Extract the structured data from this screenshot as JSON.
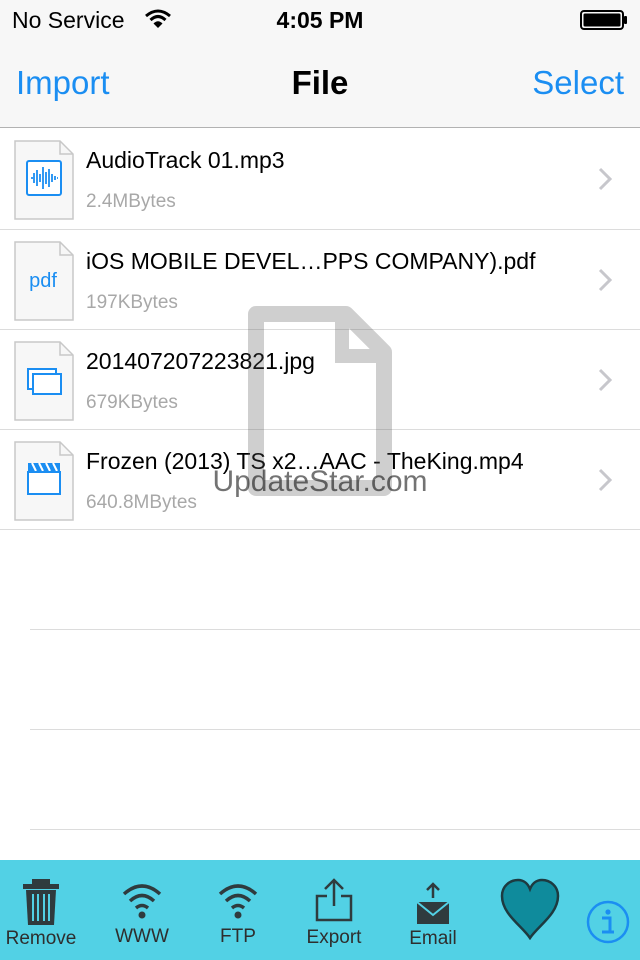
{
  "status_bar": {
    "carrier": "No Service",
    "time": "4:05 PM"
  },
  "nav_bar": {
    "left_button": "Import",
    "title": "File",
    "right_button": "Select"
  },
  "files": [
    {
      "name": "AudioTrack 01.mp3",
      "size": "2.4MBytes",
      "icon": "audio-file-icon"
    },
    {
      "name": "iOS MOBILE DEVEL…PPS COMPANY).pdf",
      "size": "197KBytes",
      "icon": "pdf-file-icon",
      "icon_text": "pdf"
    },
    {
      "name": "20140720722​3821.jpg",
      "size": "679KBytes",
      "icon": "image-file-icon"
    },
    {
      "name": "Frozen (2013) TS x2…AAC - TheKing.mp4",
      "size": "640.8MBytes",
      "icon": "video-file-icon"
    }
  ],
  "watermark": {
    "text": "UpdateStar.com"
  },
  "toolbar": {
    "remove": "Remove",
    "www": "WWW",
    "ftp": "FTP",
    "export": "Export",
    "email": "Email"
  },
  "colors": {
    "accent": "#1b8ef2",
    "toolbar_bg": "#52d1e5",
    "heart": "#0f8b9c",
    "separator": "#dcdcdc",
    "secondary_text": "#a8a8a8"
  }
}
